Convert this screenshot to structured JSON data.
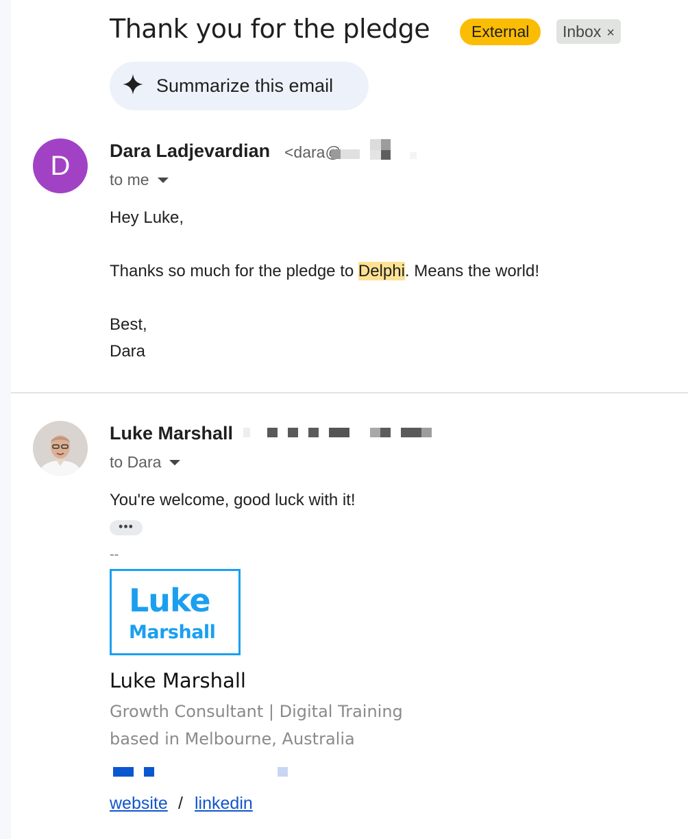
{
  "header": {
    "subject": "Thank you for the pledge",
    "label_external": "External",
    "label_inbox": "Inbox",
    "label_remove": "×",
    "summarize_label": "Summarize this email"
  },
  "messages": [
    {
      "avatar_letter": "D",
      "sender_name": "Dara Ladjevardian",
      "sender_email": "<dara@",
      "recipient": "to me",
      "body": {
        "greeting": "Hey Luke,",
        "line_before": "Thanks so much for the pledge to ",
        "highlight": "Delphi",
        "line_after": ". Means the world!",
        "signoff": "Best,",
        "signature": "Dara"
      }
    },
    {
      "sender_name": "Luke Marshall",
      "recipient": "to Dara",
      "body": {
        "text": "You're welcome, good luck with it!",
        "trimmed_indicator": "•••",
        "sig_separator": "--"
      },
      "signature": {
        "logo_line1": "Luke",
        "logo_line2": "Marshall",
        "name": "Luke Marshall",
        "title": "Growth Consultant | Digital Training",
        "location": "based in Melbourne, Australia",
        "link_website": "website",
        "link_separator": "/",
        "link_linkedin": "linkedin"
      }
    }
  ],
  "colors": {
    "external_label": "#fbbc04",
    "avatar_d": "#a142c4",
    "highlight": "#fde293",
    "logo_blue": "#1a9ff0",
    "link": "#1155cc"
  },
  "icons": {
    "summarize": "sparkle-icon",
    "recipient_toggle": "caret-down-icon"
  }
}
